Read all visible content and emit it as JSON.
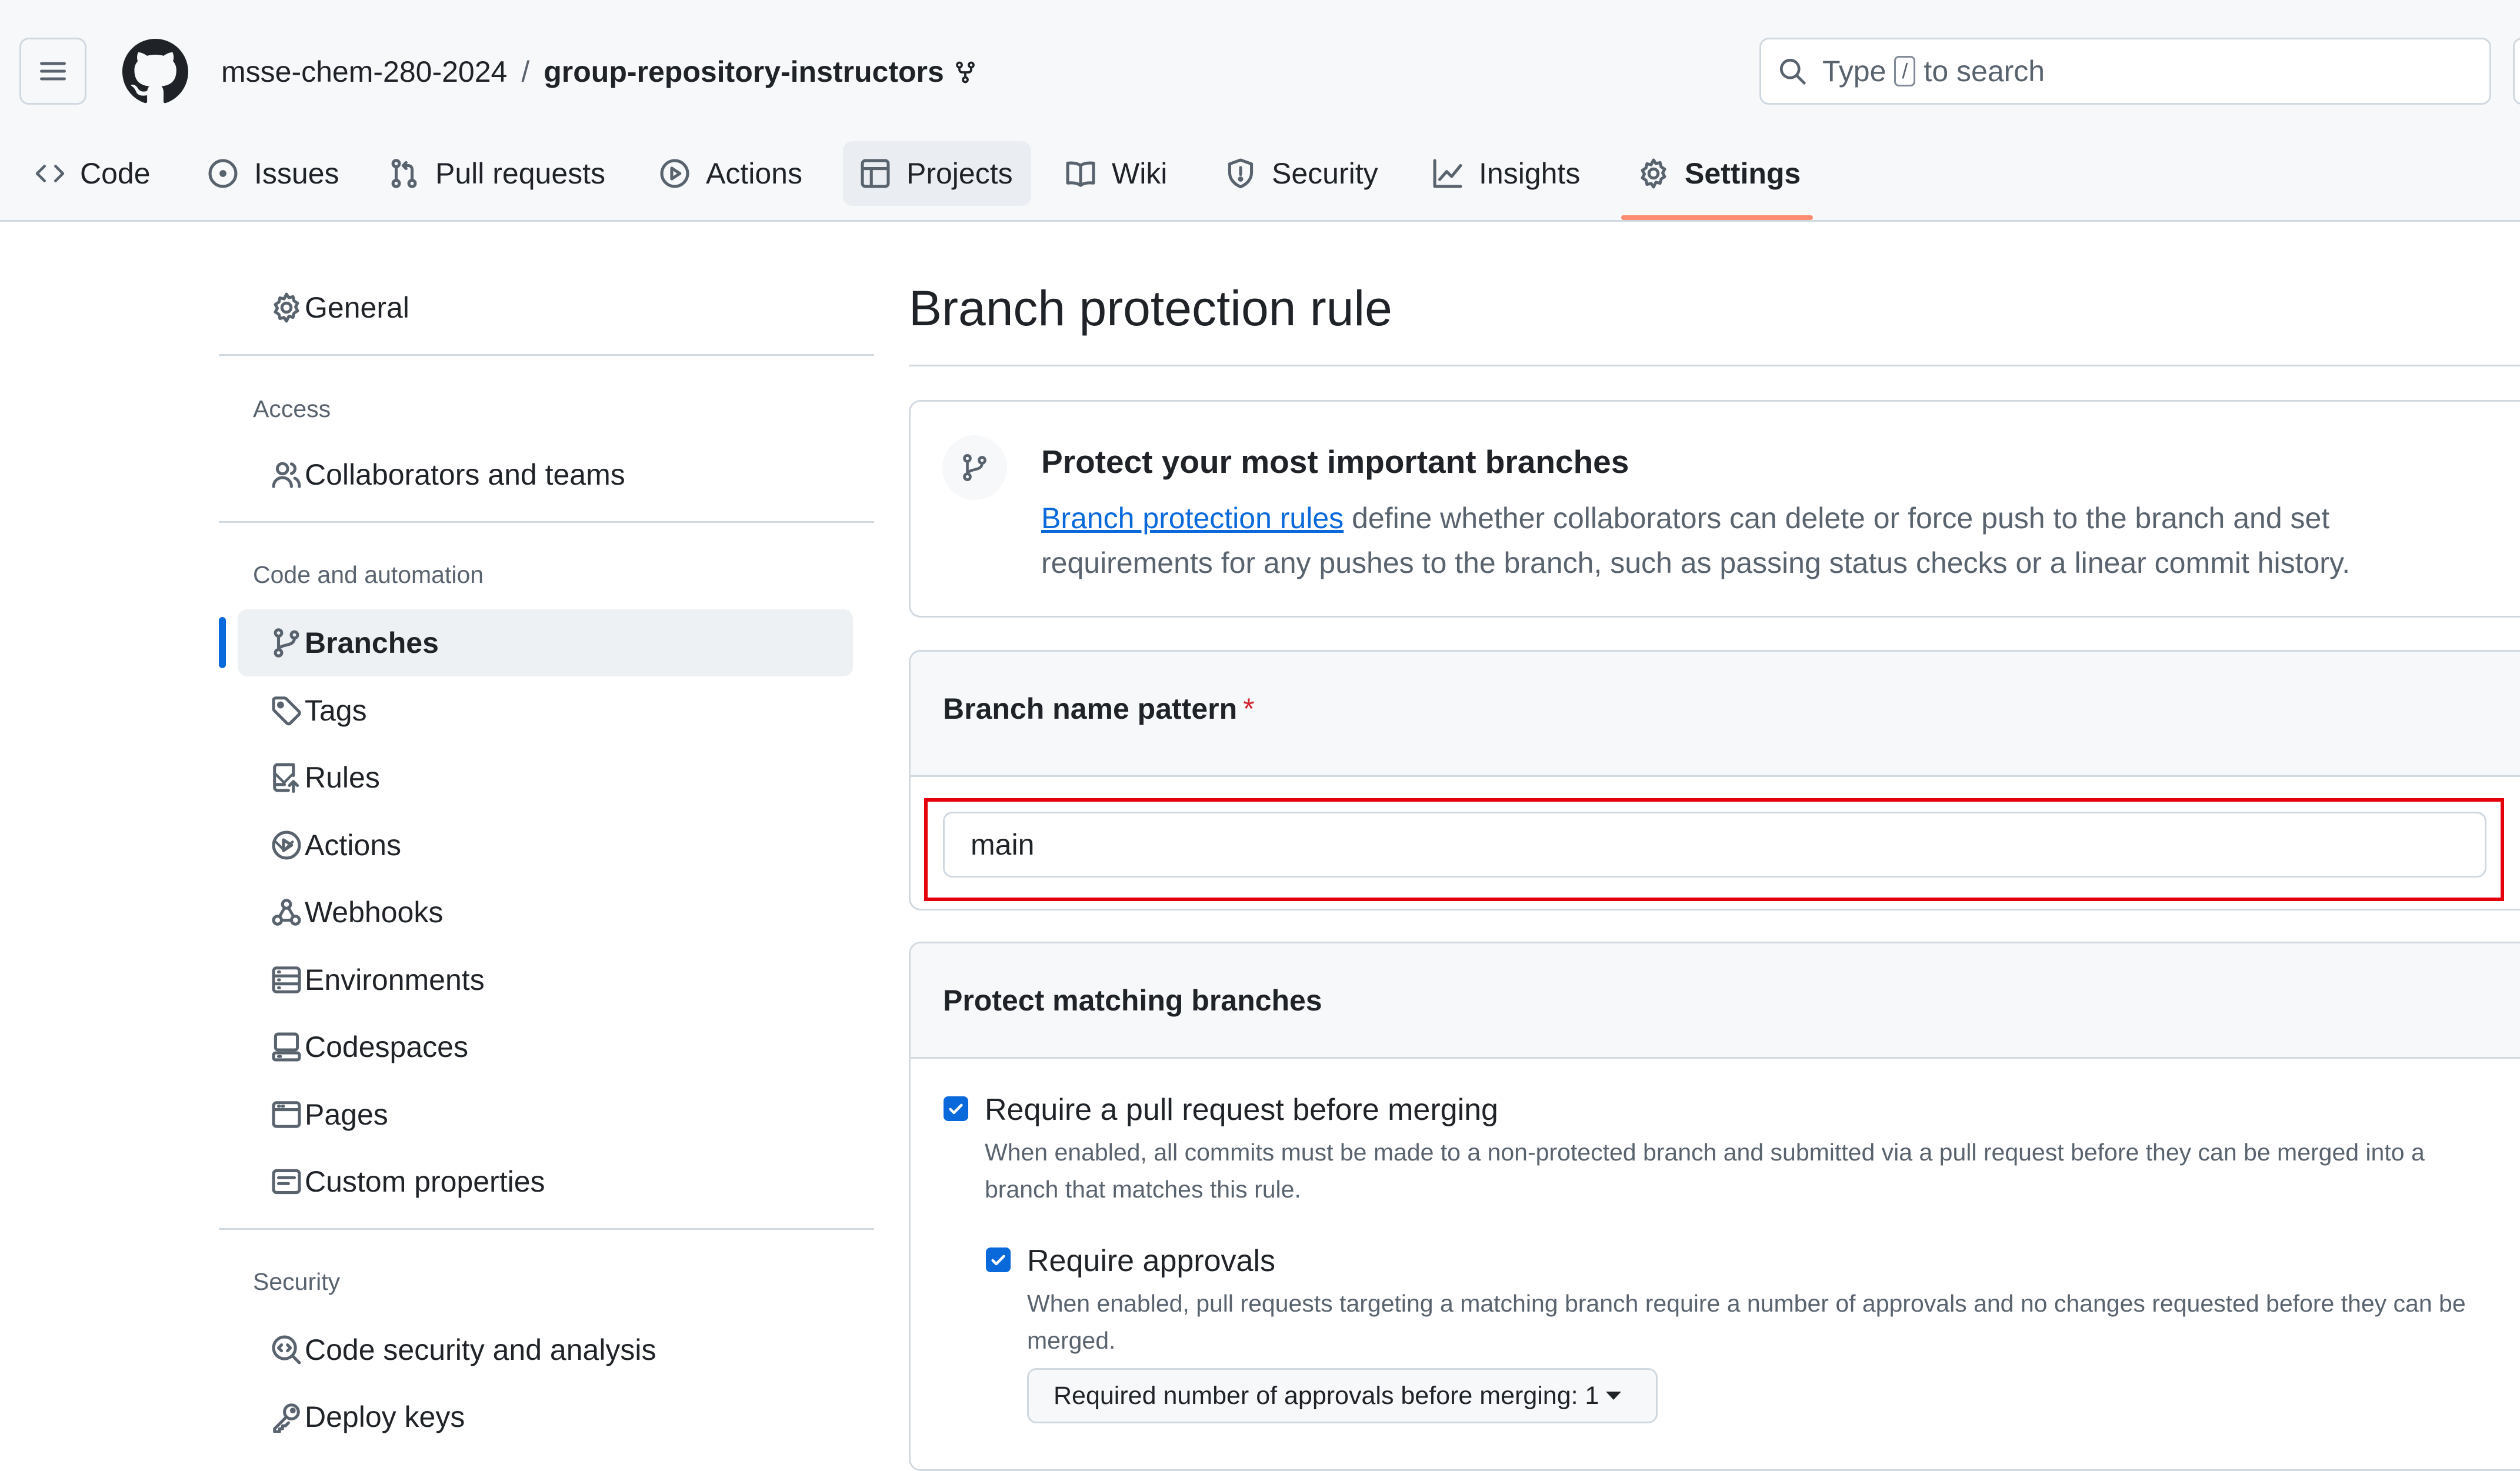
{
  "header": {
    "owner": "msse-chem-280-2024",
    "separator": "/",
    "repo": "group-repository-instructors",
    "search": {
      "prefix": "Type",
      "key": "/",
      "suffix": "to search"
    }
  },
  "tabs": [
    {
      "label": "Code",
      "icon": "code-icon"
    },
    {
      "label": "Issues",
      "icon": "issue-icon"
    },
    {
      "label": "Pull requests",
      "icon": "pull-request-icon"
    },
    {
      "label": "Actions",
      "icon": "play-icon"
    },
    {
      "label": "Projects",
      "icon": "table-icon"
    },
    {
      "label": "Wiki",
      "icon": "book-icon"
    },
    {
      "label": "Security",
      "icon": "shield-icon"
    },
    {
      "label": "Insights",
      "icon": "graph-icon"
    },
    {
      "label": "Settings",
      "icon": "gear-icon",
      "selected": true
    }
  ],
  "sidebar": {
    "general": "General",
    "access_heading": "Access",
    "collaborators": "Collaborators and teams",
    "code_heading": "Code and automation",
    "items": [
      {
        "label": "Branches",
        "active": true
      },
      {
        "label": "Tags"
      },
      {
        "label": "Rules",
        "expandable": true
      },
      {
        "label": "Actions",
        "expandable": true
      },
      {
        "label": "Webhooks"
      },
      {
        "label": "Environments"
      },
      {
        "label": "Codespaces"
      },
      {
        "label": "Pages"
      },
      {
        "label": "Custom properties"
      }
    ],
    "security_heading": "Security",
    "security_items": [
      {
        "label": "Code security and analysis"
      },
      {
        "label": "Deploy keys"
      }
    ]
  },
  "main": {
    "title": "Branch protection rule",
    "info": {
      "title": "Protect your most important branches",
      "link": "Branch protection rules",
      "text": " define whether collaborators can delete or force push to the branch and set requirements for any pushes to the branch, such as passing status checks or a linear commit history."
    },
    "pattern": {
      "label": "Branch name pattern",
      "required_mark": "*",
      "value": "main"
    },
    "protect": {
      "title": "Protect matching branches",
      "require_pr": {
        "label": "Require a pull request before merging",
        "checked": true,
        "desc": "When enabled, all commits must be made to a non-protected branch and submitted via a pull request before they can be merged into a branch that matches this rule."
      },
      "require_approvals": {
        "label": "Require approvals",
        "checked": true,
        "desc": "When enabled, pull requests targeting a matching branch require a number of approvals and no changes requested before they can be merged."
      },
      "approvals_select": "Required number of approvals before merging: 1"
    }
  },
  "colors": {
    "accent_blue": "#0969da",
    "tab_underline": "#fd8c73",
    "highlight_red": "#e3000b",
    "required_red": "#d1242f"
  }
}
